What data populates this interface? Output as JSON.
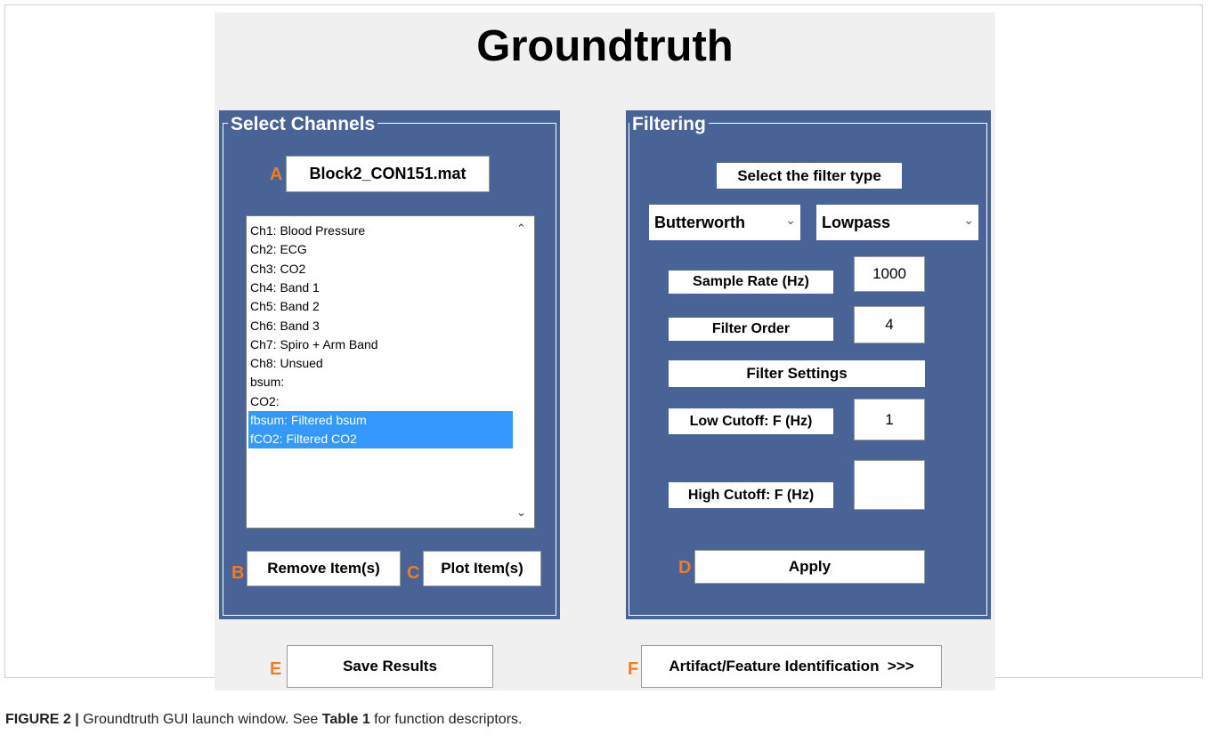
{
  "window": {
    "title": "Groundtruth"
  },
  "select_channels": {
    "legend": "Select Channels",
    "file_button": "Block2_CON151.mat",
    "channels": [
      {
        "label": "Ch1: Blood Pressure",
        "selected": false
      },
      {
        "label": "Ch2: ECG",
        "selected": false
      },
      {
        "label": "Ch3: CO2",
        "selected": false
      },
      {
        "label": "Ch4: Band 1",
        "selected": false
      },
      {
        "label": "Ch5: Band 2",
        "selected": false
      },
      {
        "label": "Ch6: Band 3",
        "selected": false
      },
      {
        "label": "Ch7: Spiro + Arm Band",
        "selected": false
      },
      {
        "label": "Ch8: Unsued",
        "selected": false
      },
      {
        "label": "bsum:",
        "selected": false
      },
      {
        "label": "CO2:",
        "selected": false
      },
      {
        "label": "fbsum: Filtered bsum",
        "selected": true
      },
      {
        "label": "fCO2: Filtered CO2",
        "selected": true
      }
    ],
    "remove_button": "Remove Item(s)",
    "plot_button": "Plot Item(s)"
  },
  "filtering": {
    "legend": "Filtering",
    "filter_type_label": "Select the filter type",
    "filter_design": "Butterworth",
    "filter_response": "Lowpass",
    "sample_rate_label": "Sample Rate (Hz)",
    "sample_rate_value": "1000",
    "filter_order_label": "Filter Order",
    "filter_order_value": "4",
    "filter_settings_label": "Filter Settings",
    "low_cutoff_label": "Low Cutoff: F (Hz)",
    "low_cutoff_value": "1",
    "high_cutoff_label": "High Cutoff: F (Hz)",
    "high_cutoff_value": "",
    "apply_button": "Apply"
  },
  "footer": {
    "save_button": "Save Results",
    "next_button": "Artifact/Feature Identification  >>>"
  },
  "markers": {
    "a": "A",
    "b": "B",
    "c": "C",
    "d": "D",
    "e": "E",
    "f": "F"
  },
  "caption": {
    "figure_label": "FIGURE 2 |",
    "text_1": " Groundtruth GUI launch window. See ",
    "table_ref": "Table 1",
    "text_2": " for function descriptors."
  },
  "colors": {
    "panel": "#4a6396",
    "selection": "#3399ff",
    "marker": "#f07d23",
    "window": "#f0f0f0"
  },
  "icons": [
    "chevron-down-icon",
    "scroll-up-icon",
    "scroll-down-icon"
  ]
}
